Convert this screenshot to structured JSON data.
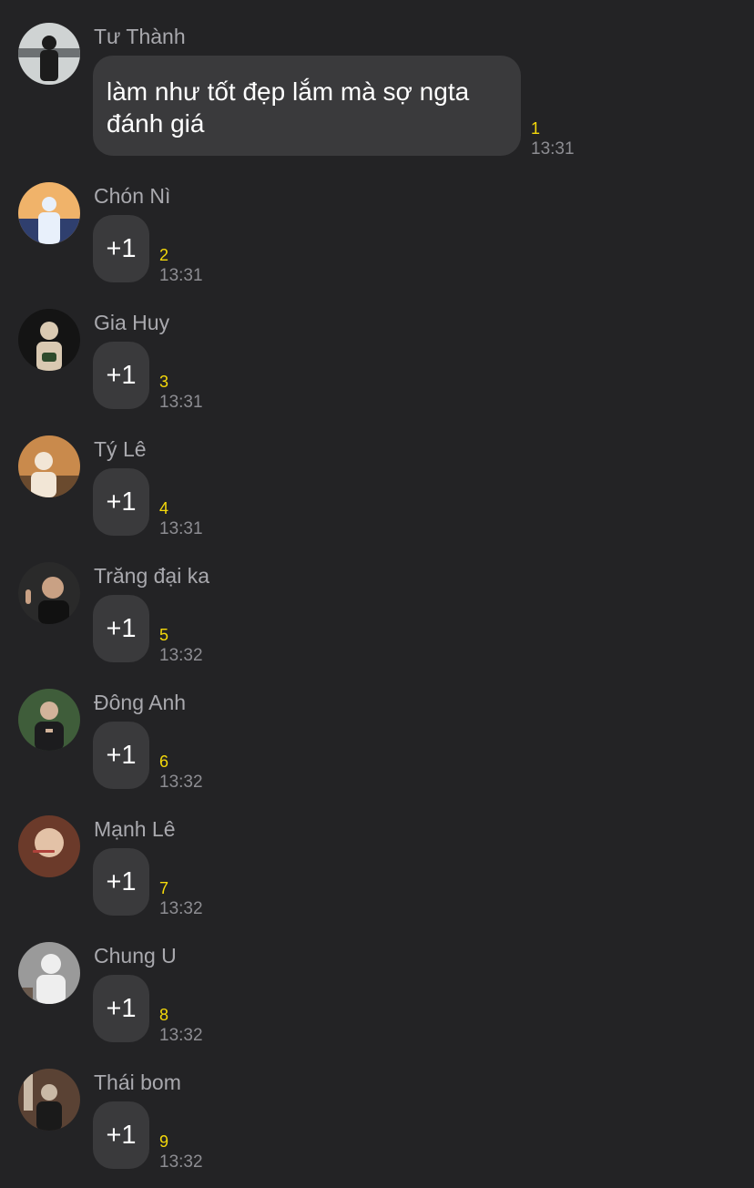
{
  "messages": [
    {
      "sender": "Tư Thành",
      "text": "làm như tốt đẹp lắm mà sợ ngta đánh giá",
      "count": "1",
      "time": "13:31",
      "colors": [
        "#cfd3d3",
        "#1c1c1c",
        "#6d7173"
      ]
    },
    {
      "sender": "Chón Nì",
      "text": "+1",
      "count": "2",
      "time": "13:31",
      "colors": [
        "#f0b36a",
        "#e8f0fb",
        "#2f3f6e"
      ]
    },
    {
      "sender": "Gia Huy",
      "text": "+1",
      "count": "3",
      "time": "13:31",
      "colors": [
        "#141414",
        "#d9c9b2",
        "#2d4a2c"
      ]
    },
    {
      "sender": "Tý Lê",
      "text": "+1",
      "count": "4",
      "time": "13:31",
      "colors": [
        "#c98a4c",
        "#f2e6d6",
        "#6a4a2e"
      ]
    },
    {
      "sender": "Trăng đại ka",
      "text": "+1",
      "count": "5",
      "time": "13:32",
      "colors": [
        "#2a2a2a",
        "#c9a184",
        "#111111"
      ]
    },
    {
      "sender": "Đông Anh",
      "text": "+1",
      "count": "6",
      "time": "13:32",
      "colors": [
        "#3f5d3a",
        "#1c1c1e",
        "#d2b39a"
      ]
    },
    {
      "sender": "Mạnh Lê",
      "text": "+1",
      "count": "7",
      "time": "13:32",
      "colors": [
        "#6b3a2a",
        "#e3c2a7",
        "#b0423b"
      ]
    },
    {
      "sender": "Chung U",
      "text": "+1",
      "count": "8",
      "time": "13:32",
      "colors": [
        "#9a9a9a",
        "#eeeeee",
        "#6a5a4e"
      ]
    },
    {
      "sender": "Thái bom",
      "text": "+1",
      "count": "9",
      "time": "13:32",
      "colors": [
        "#5a4234",
        "#1a1a1a",
        "#c9b9a6"
      ]
    }
  ]
}
